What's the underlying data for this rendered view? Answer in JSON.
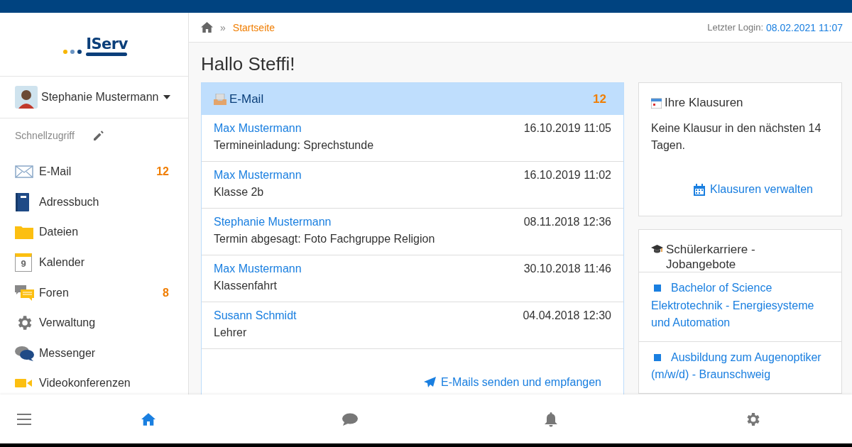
{
  "logo": {
    "text": "IServ"
  },
  "user": {
    "name": "Stephanie Mustermann"
  },
  "quick_access": {
    "label": "Schnellzugriff"
  },
  "sidebar": {
    "items": [
      {
        "kind": "mail",
        "label": "E-Mail",
        "badge": "12"
      },
      {
        "kind": "book",
        "label": "Adressbuch"
      },
      {
        "kind": "folder",
        "label": "Dateien"
      },
      {
        "kind": "calendar",
        "label": "Kalender",
        "icon_text": "9"
      },
      {
        "kind": "forum",
        "label": "Foren",
        "badge": "8"
      },
      {
        "kind": "gear",
        "label": "Verwaltung"
      },
      {
        "kind": "chat",
        "label": "Messenger"
      },
      {
        "kind": "video",
        "label": "Videokonferenzen"
      }
    ]
  },
  "breadcrumb": {
    "separator": "»",
    "current": "Startseite"
  },
  "last_login": {
    "label": "Letzter Login:",
    "value": "08.02.2021 11:07"
  },
  "greeting": "Hallo Steffi!",
  "email_panel": {
    "title": "E-Mail",
    "count": "12",
    "link": "E-Mails senden und empfangen",
    "messages": [
      {
        "sender": "Max Mustermann",
        "date": "16.10.2019 11:05",
        "subject": "Termineinladung: Sprechstunde"
      },
      {
        "sender": "Max Mustermann",
        "date": "16.10.2019 11:02",
        "subject": "Klasse 2b"
      },
      {
        "sender": "Stephanie Mustermann",
        "date": "08.11.2018 12:36",
        "subject": "Termin abgesagt: Foto Fachgruppe Religion"
      },
      {
        "sender": "Max Mustermann",
        "date": "30.10.2018 11:46",
        "subject": "Klassenfahrt"
      },
      {
        "sender": "Susann Schmidt",
        "date": "04.04.2018 12:30",
        "subject": "Lehrer"
      }
    ]
  },
  "exams_panel": {
    "title": "Ihre Klausuren",
    "text": "Keine Klausur in den nächsten 14 Tagen.",
    "link": "Klausuren verwalten"
  },
  "jobs_panel": {
    "title": "Schülerkarriere - Jobangebote",
    "jobs": [
      "Bachelor of Science Elektrotechnik - Energiesysteme und Automation",
      "Ausbildung zum Augenoptiker (m/w/d) - Braunschweig"
    ]
  },
  "bottom_nav": [
    {
      "kind": "menu",
      "selected": false
    },
    {
      "kind": "home",
      "selected": true
    },
    {
      "kind": "chat",
      "selected": false
    },
    {
      "kind": "bell",
      "selected": false
    },
    {
      "kind": "gear",
      "selected": false
    }
  ]
}
